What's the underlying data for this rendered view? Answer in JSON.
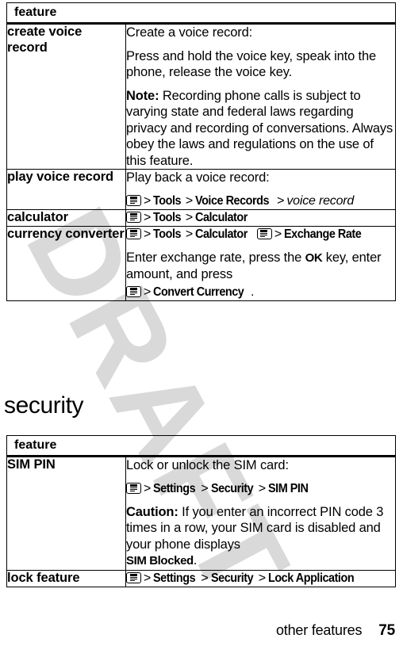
{
  "watermark": {
    "text": "DRAFT"
  },
  "tables": [
    {
      "header": "feature",
      "rows": [
        {
          "feature": "create voice record",
          "blocks": [
            {
              "kind": "text",
              "text": "Create a voice record:"
            },
            {
              "kind": "text",
              "text": "Press and hold the voice key, speak into the phone, release the voice key."
            },
            {
              "kind": "text",
              "lead": "Note:",
              "text": "Recording phone calls is subject to varying state and federal laws regarding privacy and recording of conversations. Always obey the laws and regulations on the use of this feature."
            }
          ]
        },
        {
          "feature": "play voice record",
          "blocks": [
            {
              "kind": "text",
              "text": "Play back a voice record:"
            },
            {
              "kind": "nav",
              "items": [
                "menu-icon",
                "Tools",
                "Voice Records",
                "voice record"
              ],
              "variable_index": 3
            }
          ]
        },
        {
          "feature": "calculator",
          "blocks": [
            {
              "kind": "nav",
              "items": [
                "menu-icon",
                "Tools",
                "Calculator"
              ]
            }
          ]
        },
        {
          "feature": "currency converter",
          "blocks": [
            {
              "kind": "nav",
              "items": [
                "menu-icon",
                "Tools",
                "Calculator",
                "menu-icon",
                "Exchange Rate"
              ]
            },
            {
              "kind": "text",
              "text": "Enter exchange rate, press the OK key, enter amount, and press",
              "kbd": "OK"
            },
            {
              "kind": "nav",
              "items": [
                "menu-icon",
                "Convert Currency"
              ],
              "suffix": "."
            }
          ]
        }
      ]
    },
    {
      "header": "feature",
      "rows": [
        {
          "feature": "SIM PIN",
          "blocks": [
            {
              "kind": "text",
              "text": "Lock or unlock the SIM card:"
            },
            {
              "kind": "nav",
              "items": [
                "menu-icon",
                "Settings",
                "Security",
                "SIM PIN"
              ]
            },
            {
              "kind": "text",
              "lead": "Caution:",
              "text": "If you enter an incorrect PIN code 3 times in a row, your SIM card is disabled and your phone displays SIM Blocked.",
              "kbd": "SIM Blocked"
            }
          ]
        },
        {
          "feature": "lock feature",
          "blocks": [
            {
              "kind": "nav",
              "items": [
                "menu-icon",
                "Settings",
                "Security",
                "Lock Application"
              ]
            }
          ]
        }
      ]
    }
  ],
  "section_heading": "security",
  "footer": {
    "label": "other features",
    "page": "75"
  },
  "nav_separator": ">",
  "colors": {
    "text": "#000000",
    "background": "#ffffff",
    "watermark": "#d9d9d9",
    "rule": "#000000"
  }
}
